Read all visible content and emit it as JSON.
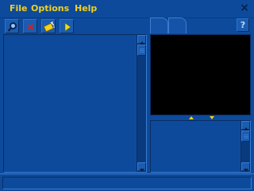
{
  "menu": {
    "file": "File",
    "options": "Options",
    "help": "Help"
  },
  "window": {
    "close_glyph": "×"
  },
  "toolbar": {
    "buttons": [
      {
        "name": "magnifier-icon"
      },
      {
        "name": "close-red-icon"
      },
      {
        "name": "wand-icon"
      },
      {
        "name": "play-icon"
      }
    ],
    "help_glyph": "?"
  },
  "status": {
    "text": ""
  },
  "colors": {
    "background": "#0d4a9c",
    "menu_text": "#f0d020",
    "video": "#000000"
  }
}
